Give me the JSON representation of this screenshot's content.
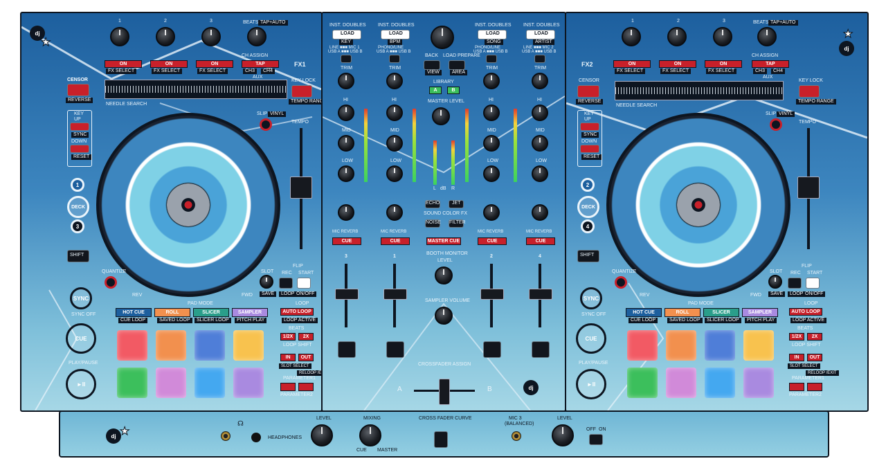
{
  "deck1": {
    "fx_numbers": [
      "1",
      "2",
      "3"
    ],
    "beats_label": "BEATS",
    "tap_auto_label": "TAP+AUTO",
    "fx_on": [
      "ON",
      "ON",
      "ON"
    ],
    "fx_select": [
      "FX SELECT",
      "FX SELECT",
      "FX SELECT"
    ],
    "tap_label": "TAP",
    "ch_assign": "CH ASSIGN",
    "ch3": "CH3",
    "ch4": "CH4",
    "aux": "AUX",
    "fx_tag": "FX1",
    "censor": "CENSOR",
    "reverse": "REVERSE",
    "needle_search": "NEEDLE SEARCH",
    "key_lock": "KEY LOCK",
    "tempo_range": "TEMPO RANGE",
    "key": "KEY",
    "up": "UP",
    "sync_small": "SYNC",
    "down": "DOWN",
    "reset": "RESET",
    "slip": "SLIP",
    "vinyl": "VINYL",
    "tempo": "TEMPO",
    "deck_label": "DECK",
    "deck_a": "1",
    "deck_b": "3",
    "shift": "SHIFT",
    "quantize": "QUANTIZE",
    "rev": "REV",
    "fwd": "FWD",
    "slot": "SLOT",
    "save": "SAVE",
    "rec": "REC",
    "loop": "LOOP",
    "flip": "FLIP",
    "start": "START",
    "on_off": "ON/OFF",
    "sync": "SYNC",
    "sync_off": "SYNC OFF",
    "cue": "CUE",
    "play_pause": "PLAY/PAUSE",
    "play_glyph": "►II",
    "pad_mode": "PAD MODE",
    "hot_cue": "HOT CUE",
    "roll": "ROLL",
    "slicer": "SLICER",
    "sampler": "SAMPLER",
    "cue_loop": "CUE LOOP",
    "saved_loop": "SAVED LOOP",
    "slicer_loop": "SLICER LOOP",
    "pitch_play": "PITCH PLAY",
    "loop_title": "LOOP",
    "auto_loop": "AUTO LOOP",
    "loop_active": "LOOP ACTIVE",
    "beats_small": "BEATS",
    "half": "1/2X",
    "double": "2X",
    "loop_shift": "LOOP SHIFT",
    "in": "IN",
    "out": "OUT",
    "slot_select": "SLOT SELECT",
    "reloop_exit": "RELOOP /EXIT",
    "parameter1": "PARAMETER1",
    "parameter2": "PARAMETER2"
  },
  "deck2": {
    "fx_numbers": [
      "1",
      "2",
      "3"
    ],
    "beats_label": "BEATS",
    "tap_auto_label": "TAP+AUTO",
    "fx_on": [
      "ON",
      "ON",
      "ON"
    ],
    "fx_select": [
      "FX SELECT",
      "FX SELECT",
      "FX SELECT"
    ],
    "tap_label": "TAP",
    "ch_assign": "CH ASSIGN",
    "ch3": "CH3",
    "ch4": "CH4",
    "aux": "AUX",
    "fx_tag": "FX2",
    "censor": "CENSOR",
    "reverse": "REVERSE",
    "needle_search": "NEEDLE SEARCH",
    "key_lock": "KEY LOCK",
    "tempo_range": "TEMPO RANGE",
    "key": "KEY",
    "up": "UP",
    "sync_small": "SYNC",
    "down": "DOWN",
    "reset": "RESET",
    "slip": "SLIP",
    "vinyl": "VINYL",
    "tempo": "TEMPO",
    "deck_label": "DECK",
    "deck_a": "2",
    "deck_b": "4",
    "shift": "SHIFT",
    "quantize": "QUANTIZE",
    "rev": "REV",
    "fwd": "FWD",
    "slot": "SLOT",
    "save": "SAVE",
    "rec": "REC",
    "loop": "LOOP",
    "flip": "FLIP",
    "start": "START",
    "on_off": "ON/OFF",
    "sync": "SYNC",
    "sync_off": "SYNC OFF",
    "cue": "CUE",
    "play_pause": "PLAY/PAUSE",
    "play_glyph": "►II",
    "pad_mode": "PAD MODE",
    "hot_cue": "HOT CUE",
    "roll": "ROLL",
    "slicer": "SLICER",
    "sampler": "SAMPLER",
    "cue_loop": "CUE LOOP",
    "saved_loop": "SAVED LOOP",
    "slicer_loop": "SLICER LOOP",
    "pitch_play": "PITCH PLAY",
    "loop_title": "LOOP",
    "auto_loop": "AUTO LOOP",
    "loop_active": "LOOP ACTIVE",
    "beats_small": "BEATS",
    "half": "1/2X",
    "double": "2X",
    "loop_shift": "LOOP SHIFT",
    "in": "IN",
    "out": "OUT",
    "slot_select": "SLOT SELECT",
    "reloop_exit": "RELOOP /EXIT",
    "parameter1": "PARAMETER1",
    "parameter2": "PARAMETER2"
  },
  "mixer": {
    "inst_doubles": "INST. DOUBLES",
    "load": "LOAD",
    "sort_labels": [
      "KEY",
      "BPM",
      "SONG",
      "ARTIST"
    ],
    "input_labels": [
      "LINE ■■■ MIC 1",
      "PHONO/LINE",
      "PHONO/LINE",
      "LINE ■■■ MIC 2"
    ],
    "usb_labels": [
      "USB A ■■■ USB B",
      "USB A ■■■ USB B",
      "USB A ■■■ USB B",
      "USB A ■■■ USB B"
    ],
    "back": "BACK",
    "load_prepare": "LOAD PREPARE",
    "view": "VIEW",
    "area": "AREA",
    "library": "LIBRARY",
    "lib_a": "A",
    "lib_b": "B",
    "master_level": "MASTER LEVEL",
    "trim": "TRIM",
    "hi": "HI",
    "mid": "MID",
    "low": "LOW",
    "echo": "ECHO",
    "jet": "JET",
    "noise": "NOISE",
    "filter": "FILTER",
    "sound_color_fx": "SOUND COLOR FX",
    "mic_reverb": "MIC REVERB",
    "cue": "CUE",
    "master_cue": "MASTER CUE",
    "booth_monitor": "BOOTH MONITOR",
    "level": "LEVEL",
    "sampler_volume": "SAMPLER VOLUME",
    "channel_numbers": [
      "3",
      "1",
      "2",
      "4"
    ],
    "crossfader_assign": "CROSSFADER ASSIGN",
    "a_side": "A",
    "b_side": "B",
    "meter_l": "L",
    "meter_db": "dB",
    "meter_r": "R"
  },
  "front": {
    "headphones": "HEADPHONES",
    "level": "LEVEL",
    "mixing": "MIXING",
    "cue": "CUE",
    "master": "MASTER",
    "crossfader_curve": "CROSS FADER CURVE",
    "mic3": "MIC 3",
    "balanced": "(BALANCED)",
    "off": "OFF",
    "on": "ON"
  },
  "colors": {
    "pad_red": "#f25a64",
    "pad_orange": "#f2904e",
    "pad_blue": "#4f7ed8",
    "pad_yellow": "#f8c24e",
    "pad_green": "#3cbf5c",
    "pad_pink": "#d18ad9",
    "pad_cyan": "#44a8f0",
    "pad_purple": "#a98ae0",
    "accent_red": "#c8202a"
  }
}
